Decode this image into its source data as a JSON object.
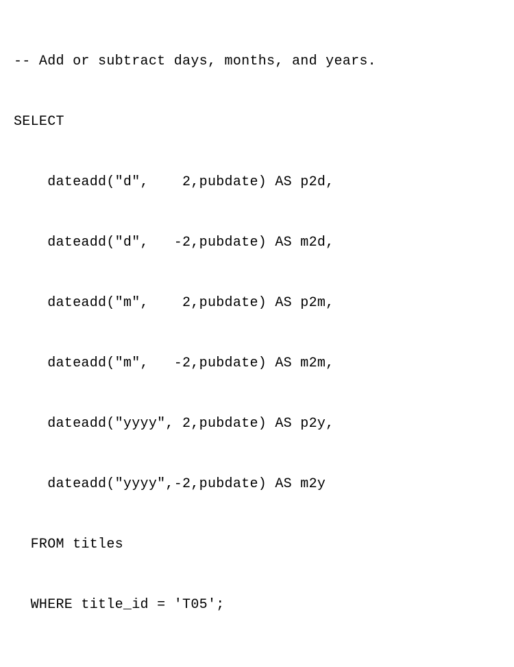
{
  "code": {
    "lines": [
      "-- Add or subtract days, months, and years.",
      "SELECT",
      "    dateadd(\"d\",    2,pubdate) AS p2d,",
      "    dateadd(\"d\",   -2,pubdate) AS m2d,",
      "    dateadd(\"m\",    2,pubdate) AS p2m,",
      "    dateadd(\"m\",   -2,pubdate) AS m2m,",
      "    dateadd(\"yyyy\", 2,pubdate) AS p2y,",
      "    dateadd(\"yyyy\",-2,pubdate) AS m2y",
      "  FROM titles",
      "  WHERE title_id = 'T05';"
    ]
  }
}
